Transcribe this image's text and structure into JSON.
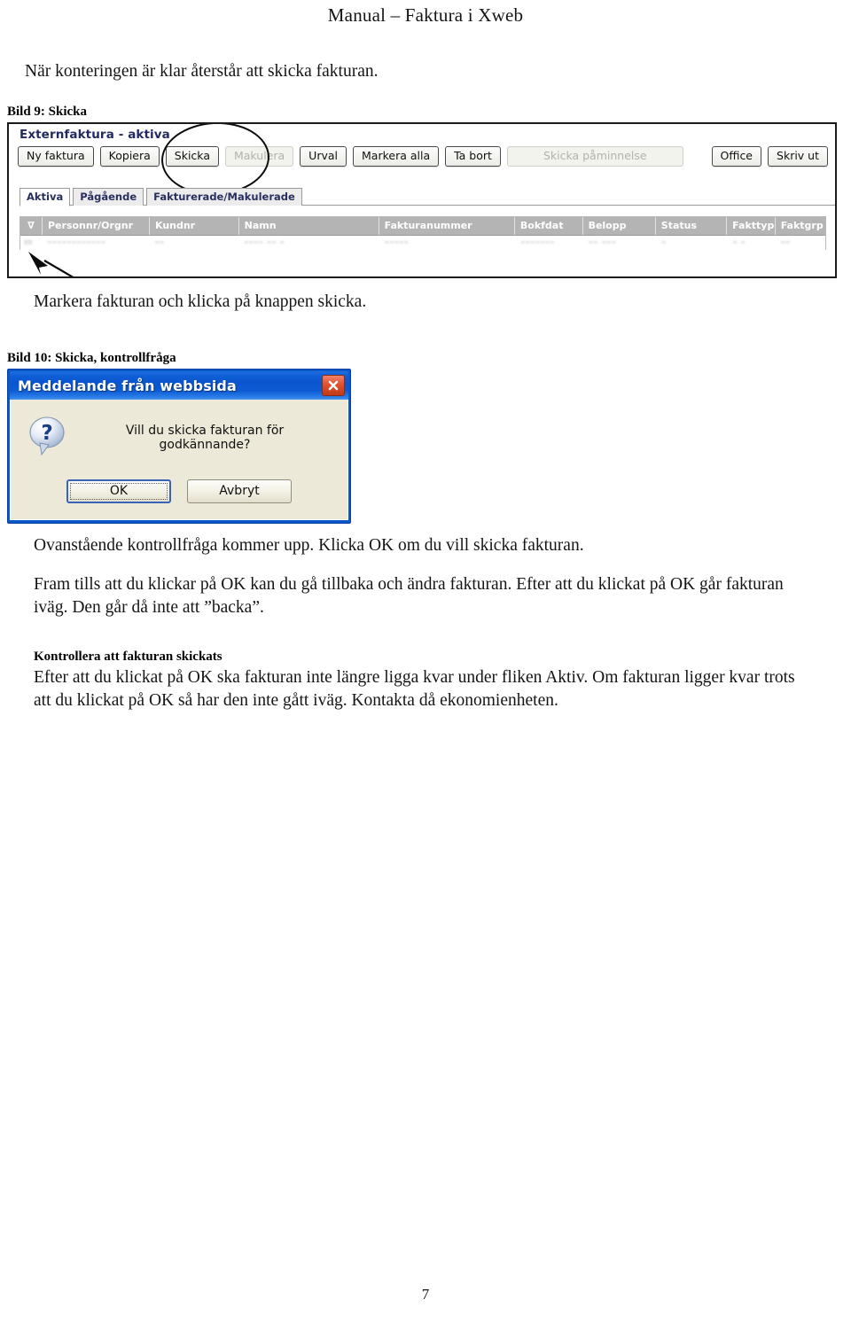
{
  "document": {
    "header_title": "Manual – Faktura i Xweb",
    "page_number": "7"
  },
  "intro": {
    "line": "När konteringen är klar återstår att skicka fakturan."
  },
  "figure9": {
    "caption": "Bild 9: Skicka",
    "app": {
      "title": "Externfaktura - aktiva",
      "toolbar": [
        {
          "label": "Ny faktura",
          "disabled": false
        },
        {
          "label": "Kopiera",
          "disabled": false
        },
        {
          "label": "Skicka",
          "disabled": false
        },
        {
          "label": "Makulera",
          "disabled": true
        },
        {
          "label": "Urval",
          "disabled": false
        },
        {
          "label": "Markera alla",
          "disabled": false
        },
        {
          "label": "Ta bort",
          "disabled": false
        },
        {
          "label": "Skicka påminnelse",
          "disabled": true
        },
        {
          "label": "Office",
          "disabled": false
        },
        {
          "label": "Skriv ut",
          "disabled": false
        }
      ],
      "tabs": [
        {
          "label": "Aktiva",
          "active": true
        },
        {
          "label": "Pågående",
          "active": false
        },
        {
          "label": "Fakturerade/Makulerade",
          "active": false
        }
      ],
      "grid": {
        "columns": [
          "",
          "Personnr/Orgnr",
          "Kundnr",
          "Namn",
          "Fakturanummer",
          "Bokfdat",
          "Belopp",
          "Status",
          "Fakttyp",
          "Faktgrp"
        ],
        "filter_icon": "filter-icon",
        "rows": [
          {
            "checkbox": "row-checkbox",
            "personnr": "––––––––––––",
            "kundnr": "––",
            "namn": "–––– –– –",
            "fakturanummer": "–––––",
            "bokfdat": "–––––––",
            "belopp": "–– –––",
            "status": "–",
            "fakttyp": "– –",
            "faktgrp": "––"
          }
        ]
      },
      "annotations": {
        "ellipse_target": "Skicka",
        "arrow_target": "row-checkbox"
      }
    }
  },
  "mid": {
    "line": "Markera fakturan och klicka på knappen skicka."
  },
  "figure10": {
    "caption": "Bild 10: Skicka, kontrollfråga",
    "dialog": {
      "title": "Meddelande från webbsida",
      "close_icon": "close-icon",
      "question_icon": "question-mark-icon",
      "message": "Vill du skicka fakturan för godkännande?",
      "buttons": [
        {
          "label": "OK",
          "default": true
        },
        {
          "label": "Avbryt",
          "default": false
        }
      ],
      "colors": {
        "titlebar": "#0a57c6",
        "body": "#ece9d8",
        "close_button": "#c13a18",
        "default_border": "#3a63b5"
      }
    }
  },
  "body": {
    "p1": "Ovanstående kontrollfråga kommer upp. Klicka OK om du vill skicka fakturan.",
    "p2": "Fram tills att du klickar på OK kan du gå tillbaka och ändra fakturan. Efter att du klickat på OK går fakturan iväg. Den går då inte att ”backa”.",
    "heading": "Kontrollera att fakturan skickats",
    "p3": "Efter att du klickat på OK ska fakturan inte längre ligga kvar under fliken Aktiv. Om fakturan ligger kvar trots att du klickat på OK så har den inte gått iväg. Kontakta då ekonomienheten."
  }
}
